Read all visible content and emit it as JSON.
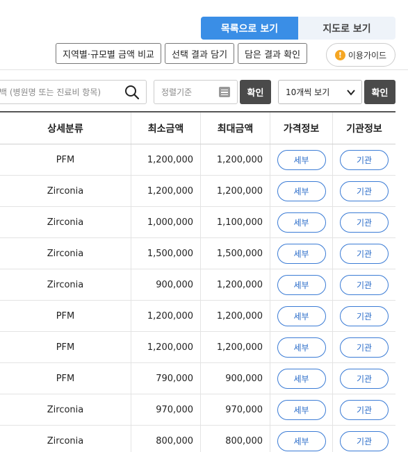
{
  "view_toggle": {
    "list_label": "목록으로 보기",
    "map_label": "지도로 보기"
  },
  "actions": {
    "compare_label": "지역별·규모별 금액 비교",
    "add_label": "선택 결과 담기",
    "view_saved_label": "담은 결과 확인",
    "guide_label": "이용가이드",
    "guide_icon_glyph": "!"
  },
  "search": {
    "placeholder": "백 (병원명 또는 진료비 항목)",
    "icon": "search-icon"
  },
  "sort": {
    "placeholder": "정렬기준",
    "icon": "list-icon",
    "confirm_label": "확인"
  },
  "page_size": {
    "selected": "10개씩 보기",
    "icon": "chevron-down-icon",
    "confirm_label": "확인"
  },
  "table": {
    "headers": [
      "상세분류",
      "최소금액",
      "최대금액",
      "가격정보",
      "기관정보"
    ],
    "detail_label": "세부",
    "org_label": "기관",
    "rows": [
      {
        "category": "PFM",
        "min": "1,200,000",
        "max": "1,200,000"
      },
      {
        "category": "Zirconia",
        "min": "1,200,000",
        "max": "1,200,000"
      },
      {
        "category": "Zirconia",
        "min": "1,000,000",
        "max": "1,100,000"
      },
      {
        "category": "Zirconia",
        "min": "1,500,000",
        "max": "1,500,000"
      },
      {
        "category": "Zirconia",
        "min": "900,000",
        "max": "1,200,000"
      },
      {
        "category": "PFM",
        "min": "1,200,000",
        "max": "1,200,000"
      },
      {
        "category": "PFM",
        "min": "1,200,000",
        "max": "1,200,000"
      },
      {
        "category": "PFM",
        "min": "790,000",
        "max": "900,000"
      },
      {
        "category": "Zirconia",
        "min": "970,000",
        "max": "970,000"
      },
      {
        "category": "Zirconia",
        "min": "800,000",
        "max": "800,000"
      }
    ]
  },
  "colors": {
    "accent": "#3a8ee6",
    "pill_border": "#3a7bd5",
    "dark_button": "#4a4a4a",
    "guide_icon": "#f5a623"
  }
}
